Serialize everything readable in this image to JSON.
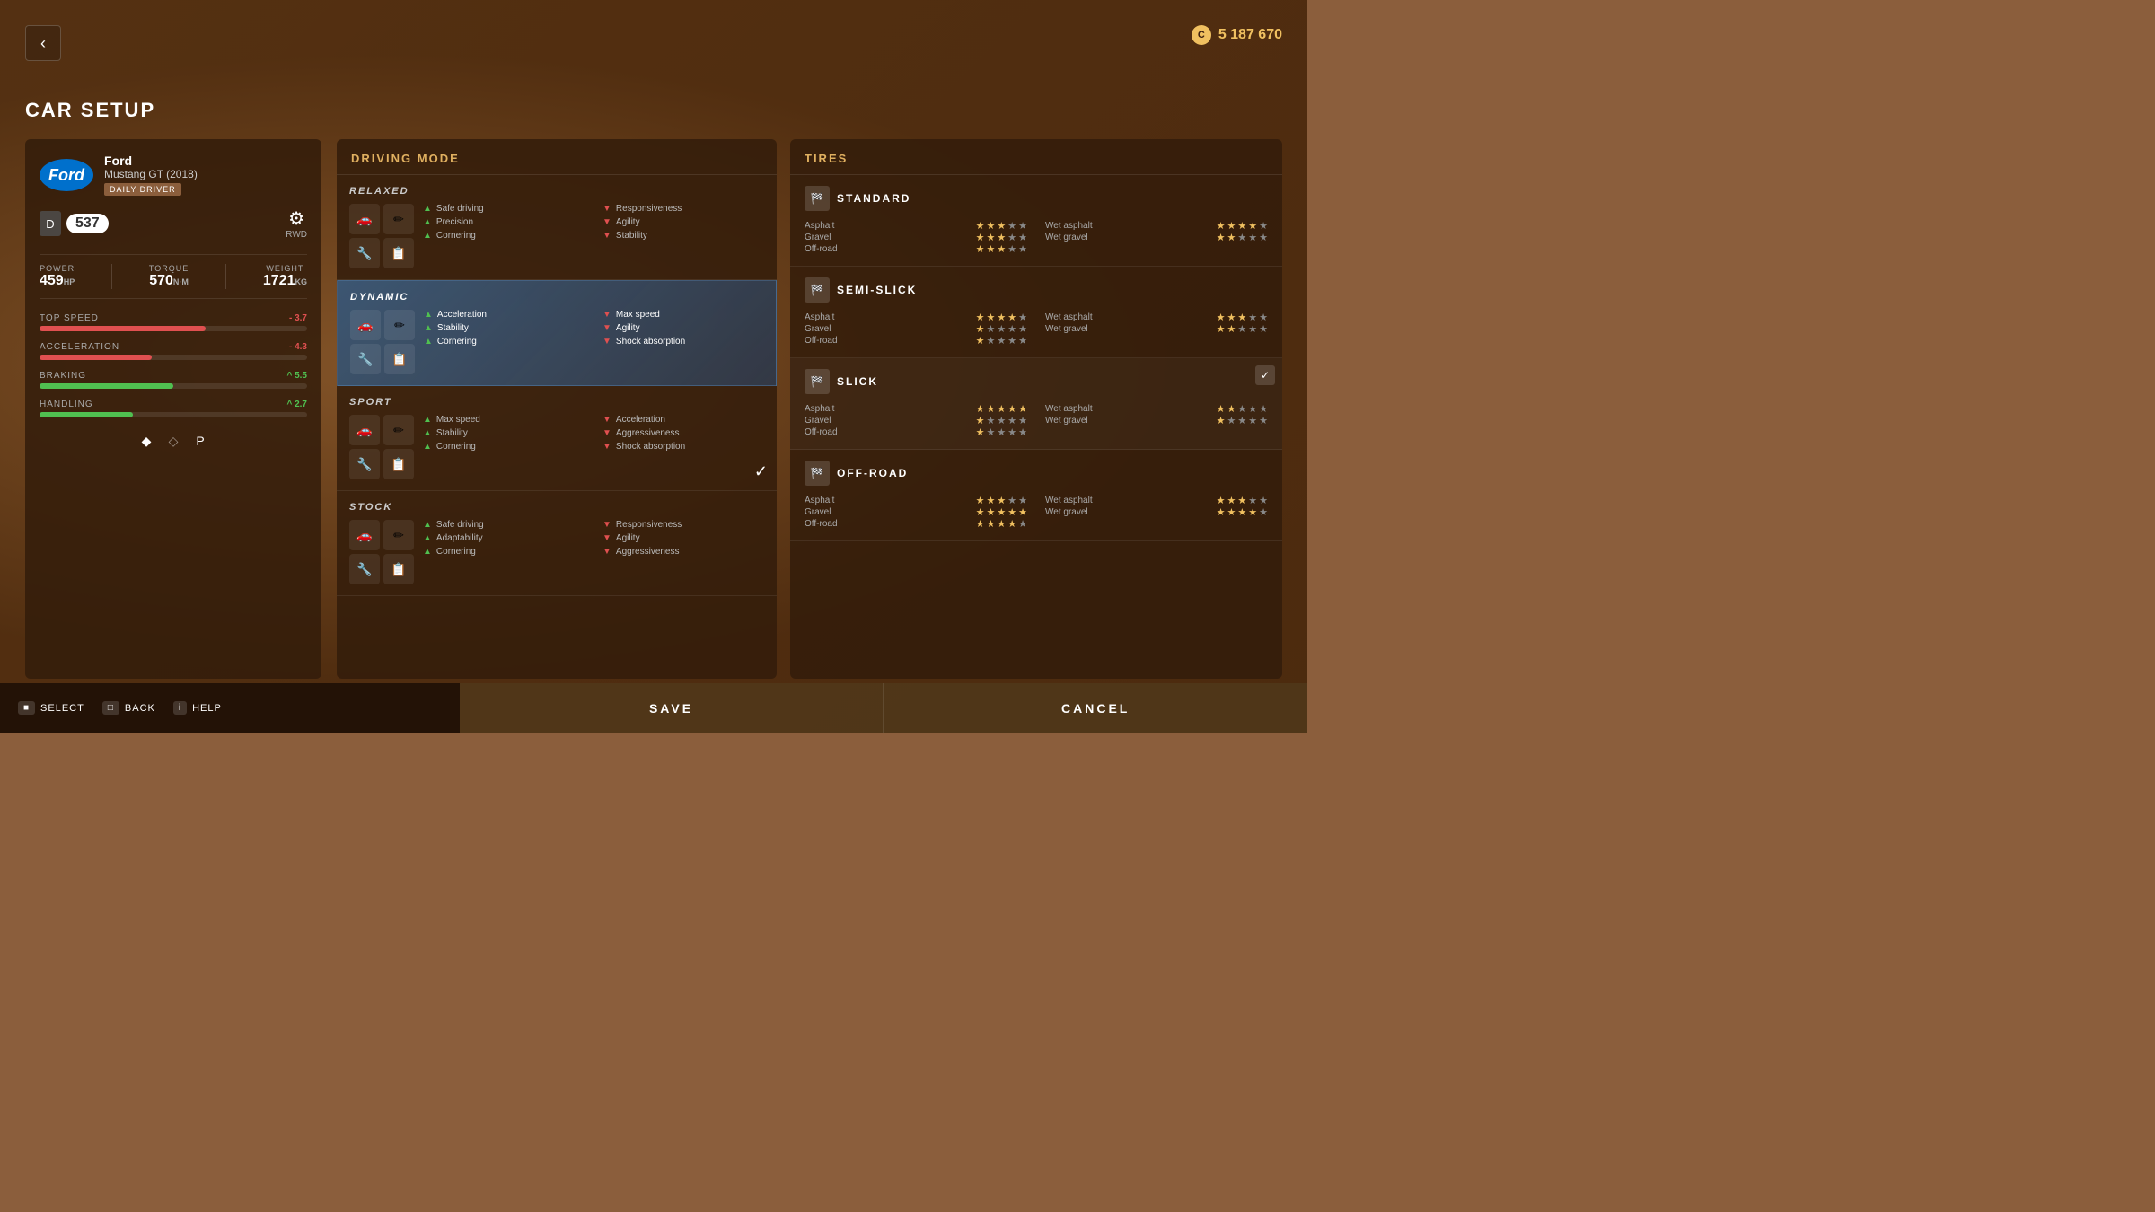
{
  "header": {
    "back_label": "‹",
    "currency_icon": "C",
    "currency_amount": "5 187 670"
  },
  "page_title": "CAR SETUP",
  "car": {
    "brand": "Ford",
    "model": "Mustang GT (2018)",
    "badge": "DAILY DRIVER",
    "rating_letter": "D",
    "rating_number": "537",
    "transmission": "RWD",
    "power_label": "POWER",
    "power_value": "459",
    "power_unit": "HP",
    "torque_label": "TORQUE",
    "torque_value": "570",
    "torque_unit": "N·M",
    "weight_label": "WEIGHT",
    "weight_value": "1721",
    "weight_unit": "KG"
  },
  "stats": [
    {
      "label": "TOP SPEED",
      "delta": "- 3.7",
      "delta_type": "neg",
      "fill": 62
    },
    {
      "label": "ACCELERATION",
      "delta": "- 4.3",
      "delta_type": "neg",
      "fill": 42
    },
    {
      "label": "BRAKING",
      "delta": "^ 5.5",
      "delta_type": "pos",
      "fill": 50
    },
    {
      "label": "HANDLING",
      "delta": "^ 2.7",
      "delta_type": "pos",
      "fill": 35
    }
  ],
  "driving_mode_title": "DRIVING MODE",
  "modes": [
    {
      "name": "RELAXED",
      "active": false,
      "pros": [
        "Safe driving",
        "Precision",
        "Cornering"
      ],
      "cons": [
        "Responsiveness",
        "Agility",
        "Stability"
      ]
    },
    {
      "name": "DYNAMIC",
      "active": true,
      "pros": [
        "Acceleration",
        "Stability",
        "Cornering"
      ],
      "cons": [
        "Max speed",
        "Agility",
        "Shock absorption"
      ]
    },
    {
      "name": "SPORT",
      "active": false,
      "selected": true,
      "pros": [
        "Max speed",
        "Stability",
        "Cornering"
      ],
      "cons": [
        "Acceleration",
        "Aggressiveness",
        "Shock absorption"
      ]
    },
    {
      "name": "STOCK",
      "active": false,
      "pros": [
        "Safe driving",
        "Adaptability",
        "Cornering"
      ],
      "cons": [
        "Responsiveness",
        "Agility",
        "Aggressiveness"
      ]
    }
  ],
  "tires_title": "TIRES",
  "tires": [
    {
      "name": "STANDARD",
      "selected": false,
      "stats": [
        {
          "surface": "Asphalt",
          "stars": 3
        },
        {
          "surface": "Wet asphalt",
          "stars": 4
        },
        {
          "surface": "Gravel",
          "stars": 3
        },
        {
          "surface": "Wet gravel",
          "stars": 2
        },
        {
          "surface": "Off-road",
          "stars": 3
        },
        {
          "surface": "",
          "stars": 0
        }
      ]
    },
    {
      "name": "SEMI-SLICK",
      "selected": false,
      "stats": [
        {
          "surface": "Asphalt",
          "stars": 4
        },
        {
          "surface": "Wet asphalt",
          "stars": 3
        },
        {
          "surface": "Gravel",
          "stars": 1
        },
        {
          "surface": "Wet gravel",
          "stars": 2
        },
        {
          "surface": "Off-road",
          "stars": 1
        },
        {
          "surface": "",
          "stars": 0
        }
      ]
    },
    {
      "name": "SLICK",
      "selected": true,
      "stats": [
        {
          "surface": "Asphalt",
          "stars": 5
        },
        {
          "surface": "Wet asphalt",
          "stars": 2
        },
        {
          "surface": "Gravel",
          "stars": 1
        },
        {
          "surface": "Wet gravel",
          "stars": 1
        },
        {
          "surface": "Off-road",
          "stars": 1
        },
        {
          "surface": "",
          "stars": 0
        }
      ]
    },
    {
      "name": "OFF-ROAD",
      "selected": false,
      "stats": [
        {
          "surface": "Asphalt",
          "stars": 3
        },
        {
          "surface": "Wet asphalt",
          "stars": 3
        },
        {
          "surface": "Gravel",
          "stars": 5
        },
        {
          "surface": "Wet gravel",
          "stars": 4
        },
        {
          "surface": "Off-road",
          "stars": 4
        },
        {
          "surface": "",
          "stars": 0
        }
      ]
    }
  ],
  "bottom": {
    "select_hint": "SELECT",
    "back_hint": "BACK",
    "help_hint": "HELP",
    "save_label": "SAVE",
    "cancel_label": "CANCEL"
  }
}
